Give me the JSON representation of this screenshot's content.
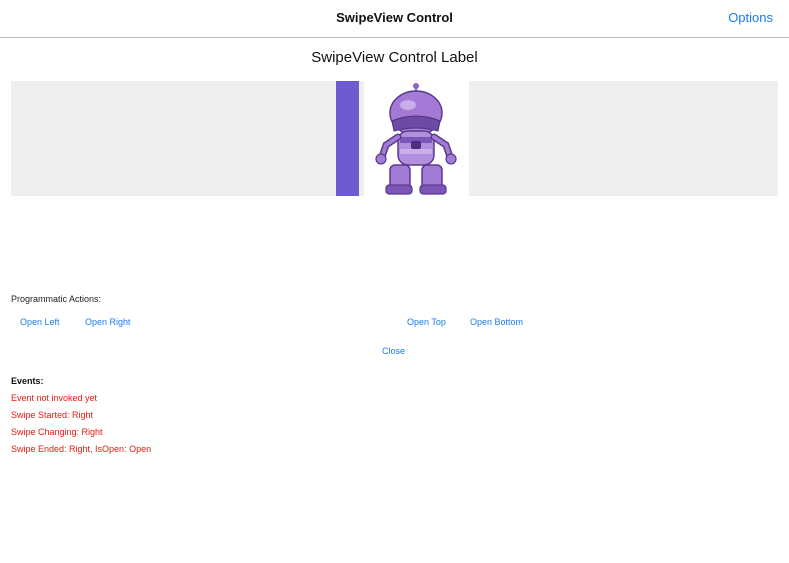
{
  "nav": {
    "title": "SwipeView Control",
    "options_label": "Options"
  },
  "page": {
    "label": "SwipeView Control Label"
  },
  "swipe": {
    "item_color": "#6e5bd0",
    "row_bg": "#efefef",
    "content_icon": "purple-robot-mascot-icon"
  },
  "actions": {
    "title": "Programmatic Actions:",
    "open_left": "Open Left",
    "open_right": "Open Right",
    "open_top": "Open Top",
    "open_bottom": "Open Bottom",
    "close": "Close"
  },
  "events": {
    "title": "Events:",
    "lines": [
      "Event not invoked yet",
      "Swipe Started: Right",
      "Swipe Changing: Right",
      "Swipe Ended: Right, IsOpen: Open"
    ]
  },
  "colors": {
    "accent": "#1a7cf0",
    "event_text": "#e8190e"
  }
}
